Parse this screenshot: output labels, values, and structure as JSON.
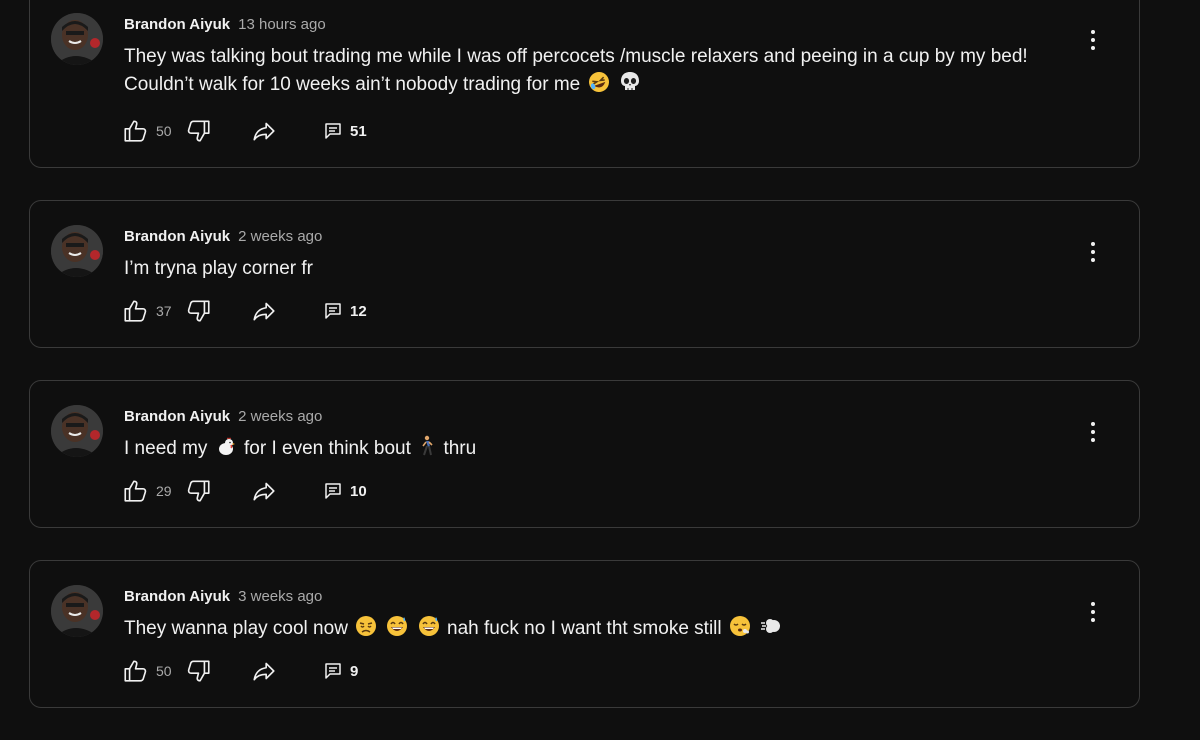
{
  "comments": [
    {
      "author": "Brandon Aiyuk",
      "time": "13 hours ago",
      "text_parts": [
        "They was talking bout trading me while I was off percocets /muscle relaxers and peeing in a cup by my bed! Couldn’t walk for 10 weeks ain’t nobody trading for me"
      ],
      "emojis": [
        "rolling-on-floor-laughing-emoji",
        "skull-emoji"
      ],
      "likes": "50",
      "replies": "51"
    },
    {
      "author": "Brandon Aiyuk",
      "time": "2 weeks ago",
      "text_parts": [
        "I’m tryna play corner fr"
      ],
      "likes": "37",
      "replies": "12"
    },
    {
      "author": "Brandon Aiyuk",
      "time": "2 weeks ago",
      "text_parts": [
        "I need my",
        "for I even think bout",
        "thru"
      ],
      "emojis": [
        "chicken-emoji",
        "person-walking-emoji"
      ],
      "likes": "29",
      "replies": "10"
    },
    {
      "author": "Brandon Aiyuk",
      "time": "3 weeks ago",
      "text_parts": [
        "They wanna play cool now",
        "nah fuck no I want tht smoke still"
      ],
      "emojis": [
        "disappointed-face-emoji",
        "grinning-sweat-emoji",
        "grinning-sweat-emoji",
        "face-exhaling-emoji",
        "dashing-away-emoji"
      ],
      "likes": "50",
      "replies": "9"
    }
  ],
  "colors": {
    "background": "#0f0f0f",
    "card_border": "#3a3a3a",
    "text_primary": "#f1f1f1",
    "text_secondary": "#aaaaaa"
  },
  "icons": {
    "like": "thumbs-up-icon",
    "dislike": "thumbs-down-icon",
    "share": "share-icon",
    "reply": "reply-icon",
    "menu": "more-vertical-icon"
  }
}
